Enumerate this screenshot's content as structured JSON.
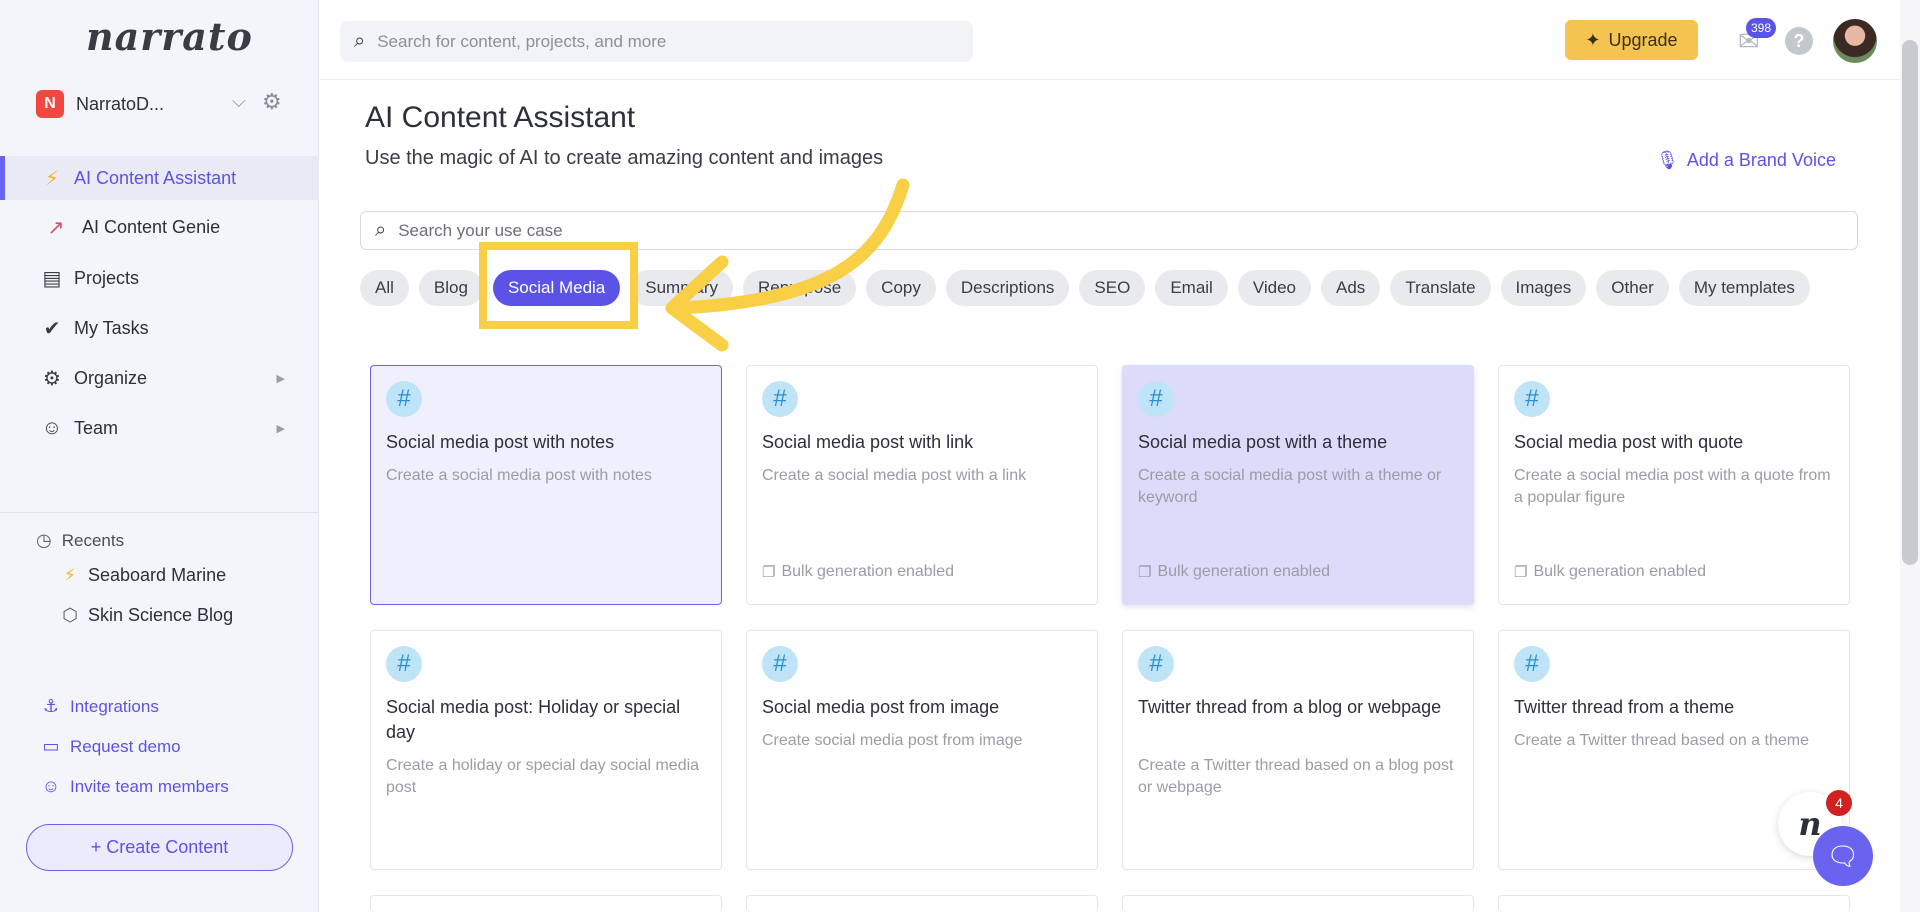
{
  "sidebar": {
    "logo": "narrato",
    "workspace": {
      "badge": "N",
      "name": "NarratoD..."
    },
    "nav": [
      {
        "label": "AI Content Assistant",
        "icon": "lightning-icon"
      },
      {
        "label": "AI Content Genie",
        "icon": "rocket-icon"
      },
      {
        "label": "Projects",
        "icon": "briefcase-icon"
      },
      {
        "label": "My Tasks",
        "icon": "checks-icon"
      },
      {
        "label": "Organize",
        "icon": "gears-icon"
      },
      {
        "label": "Team",
        "icon": "team-icon"
      }
    ],
    "recents_title": "Recents",
    "recents": [
      {
        "label": "Seaboard Marine",
        "icon": "lightning-icon"
      },
      {
        "label": "Skin Science Blog",
        "icon": "cube-icon"
      }
    ],
    "links": [
      {
        "label": "Integrations",
        "icon": "anchor-icon"
      },
      {
        "label": "Request demo",
        "icon": "monitor-icon"
      },
      {
        "label": "Invite team members",
        "icon": "add-user-icon"
      }
    ],
    "create_button": "+ Create Content"
  },
  "topbar": {
    "search_placeholder": "Search for content, projects, and more",
    "upgrade_label": "Upgrade",
    "mail_count": "398"
  },
  "main": {
    "title": "AI Content Assistant",
    "subtitle": "Use the magic of AI to create amazing content and images",
    "brand_voice_label": "Add a Brand Voice",
    "usecase_placeholder": "Search your use case",
    "filters": [
      "All",
      "Blog",
      "Social Media",
      "Summary",
      "Repurpose",
      "Copy",
      "Descriptions",
      "SEO",
      "Email",
      "Video",
      "Ads",
      "Translate",
      "Images",
      "Other",
      "My templates"
    ],
    "active_filter": "Social Media",
    "cards": [
      {
        "title": "Social media post with notes",
        "desc": "Create a social media post with notes",
        "bulk": ""
      },
      {
        "title": "Social media post with link",
        "desc": "Create a social media post with a link",
        "bulk": "Bulk generation enabled"
      },
      {
        "title": "Social media post with a theme",
        "desc": "Create a social media post with a theme or keyword",
        "bulk": "Bulk generation enabled"
      },
      {
        "title": "Social media post with quote",
        "desc": "Create a social media post with a quote from a popular figure",
        "bulk": "Bulk generation enabled"
      },
      {
        "title": "Social media post: Holiday or special day",
        "desc": "Create a holiday or special day social media post",
        "bulk": ""
      },
      {
        "title": "Social media post from image",
        "desc": "Create social media post from image",
        "bulk": ""
      },
      {
        "title": "Twitter thread from a blog or webpage",
        "desc": "Create a Twitter thread based on a blog post or webpage",
        "bulk": ""
      },
      {
        "title": "Twitter thread from a theme",
        "desc": "Create a Twitter thread based on a theme",
        "bulk": ""
      }
    ]
  },
  "chat": {
    "logo": "n",
    "unread": "4"
  },
  "colors": {
    "accent": "#5b53e6",
    "upgrade": "#f5c350",
    "annotation": "#f9cf45",
    "badge": "#f0483e"
  }
}
